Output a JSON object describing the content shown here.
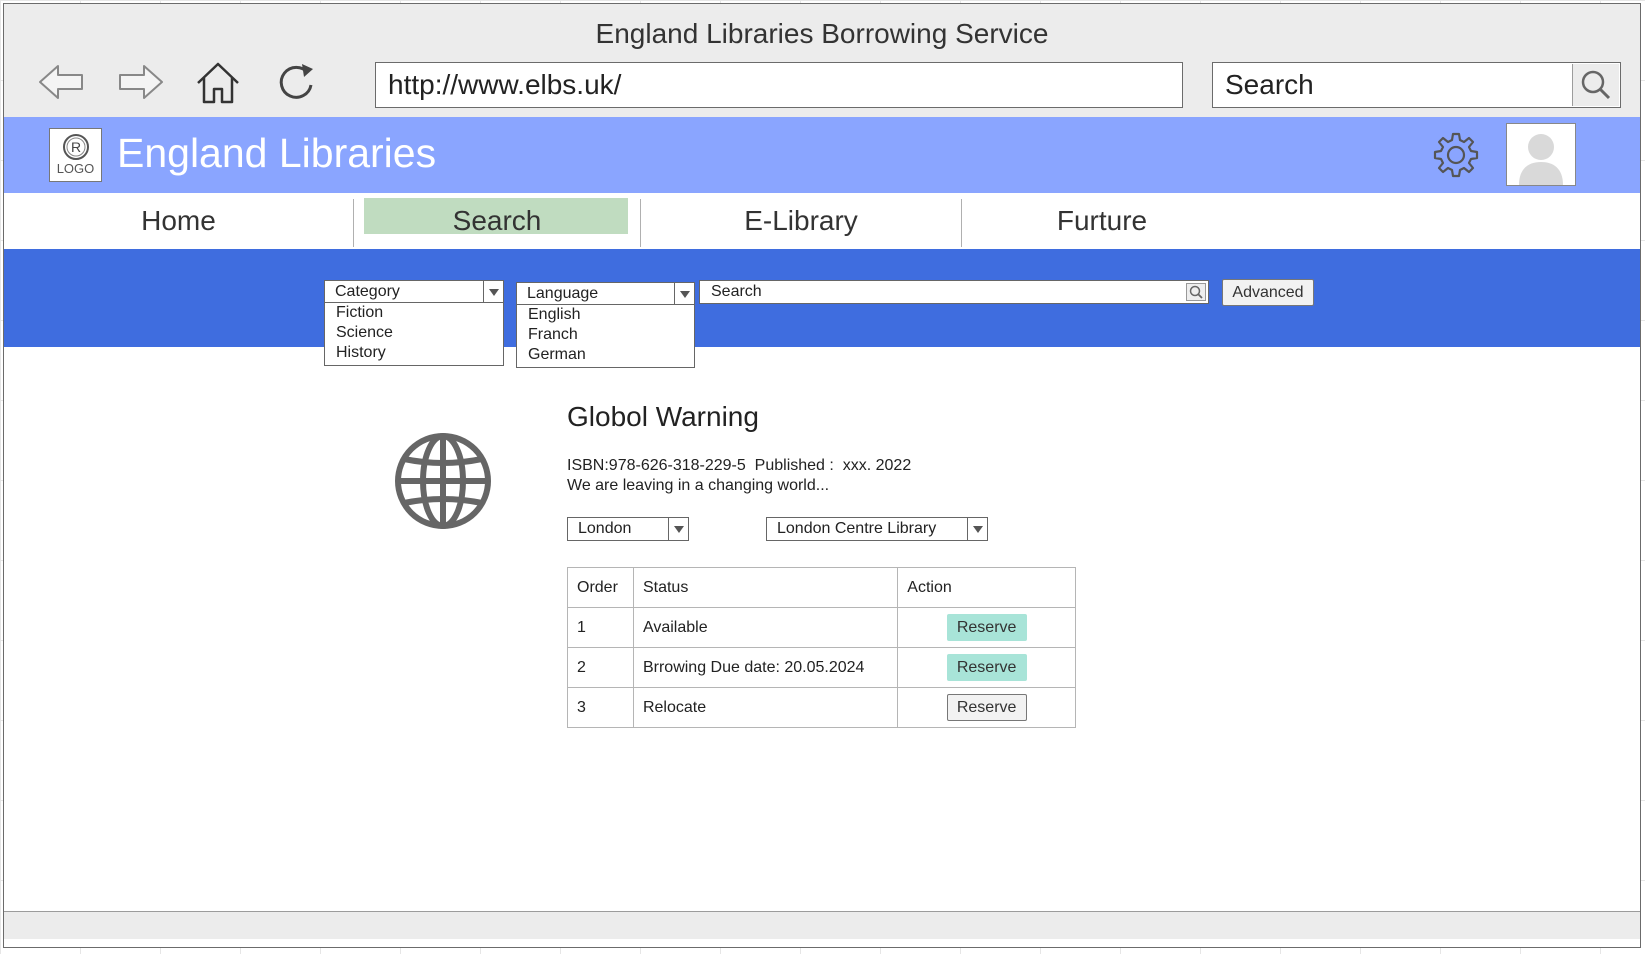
{
  "window": {
    "title": "England Libraries Borrowing Service",
    "url": "http://www.elbs.uk/",
    "search_placeholder": "Search"
  },
  "icons": {
    "back": "arrow-left-icon",
    "forward": "arrow-right-icon",
    "home": "home-icon",
    "refresh": "refresh-icon",
    "search": "search-icon",
    "settings": "gear-icon",
    "user": "user-avatar-icon",
    "book": "globe-icon"
  },
  "header": {
    "logo_text": "LOGO",
    "brand": "England Libraries",
    "brand_color": "#8aa5ff"
  },
  "nav": {
    "tabs": [
      {
        "label": "Home"
      },
      {
        "label": "Search",
        "active": true
      },
      {
        "label": "E-Library"
      },
      {
        "label": "Furture"
      }
    ],
    "active_color": "#c0dcc0"
  },
  "search_bar": {
    "band_color": "#3f6ddf",
    "category": {
      "label": "Category",
      "options": [
        "Fiction",
        "Science",
        "History"
      ]
    },
    "language": {
      "label": "Language",
      "options": [
        "English",
        "Franch",
        "German"
      ]
    },
    "search_text": "Search",
    "advanced_label": "Advanced"
  },
  "book": {
    "title": "Globol Warning",
    "meta": "ISBN:978-626-318-229-5  Published :  xxx. 2022",
    "description": "We are leaving in a changing world...",
    "city": "London",
    "library": "London Centre Library"
  },
  "availability": {
    "headers": [
      "Order",
      "Status",
      "Action"
    ],
    "rows": [
      {
        "order": "1",
        "status": "Available",
        "action": "Reserve",
        "enabled": true
      },
      {
        "order": "2",
        "status": "Brrowing Due date: 20.05.2024",
        "action": "Reserve",
        "enabled": true
      },
      {
        "order": "3",
        "status": "Relocate",
        "action": "Reserve",
        "enabled": false
      }
    ],
    "enabled_color": "#a8e4d8"
  }
}
